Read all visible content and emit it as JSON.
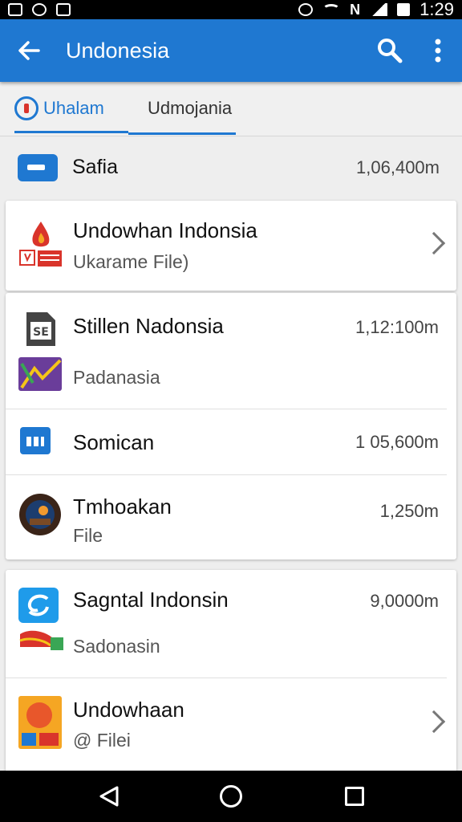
{
  "status_bar": {
    "carrier_text": "N",
    "time": "1:29",
    "icons": [
      "notification-icon",
      "clock-app-icon",
      "sim-icon",
      "alarm-icon",
      "wifi-icon",
      "signal-icon",
      "battery-icon"
    ]
  },
  "app_bar": {
    "title": "Undonesia",
    "back_icon": "arrow-left-icon",
    "search_icon": "search-icon",
    "menu_icon": "more-vert-icon",
    "color": "#1f78d1"
  },
  "tabs": [
    {
      "label": "Uhalam",
      "active": true
    },
    {
      "label": "Udmojania",
      "active": false
    }
  ],
  "header_row": {
    "label": "Safia",
    "value": "1,06,400m"
  },
  "cards": [
    {
      "items": [
        {
          "title": "Undowhan Indonsia",
          "subtitle": "Ukarame File)",
          "value": "",
          "has_chevron": true
        }
      ]
    },
    {
      "items": [
        {
          "title": "Stillen Nadonsia",
          "subtitle": "Padanasia",
          "value": "1,12:100m",
          "has_chevron": false
        },
        {
          "title": "Somican",
          "subtitle": "",
          "value": "1 05,600m",
          "has_chevron": false
        },
        {
          "title": "Tmhoakan",
          "subtitle": "File",
          "value": "1,250m",
          "has_chevron": false
        }
      ]
    },
    {
      "items": [
        {
          "title": "Sagntal Indonsin",
          "subtitle": "Sadonasin",
          "value": "9,0000m",
          "has_chevron": false
        },
        {
          "title": "Undowhaan",
          "subtitle": "@ Filei",
          "value": "",
          "has_chevron": true
        }
      ]
    }
  ],
  "nav_bar": {
    "icons": [
      "nav-back-icon",
      "nav-home-icon",
      "nav-recents-icon"
    ]
  }
}
